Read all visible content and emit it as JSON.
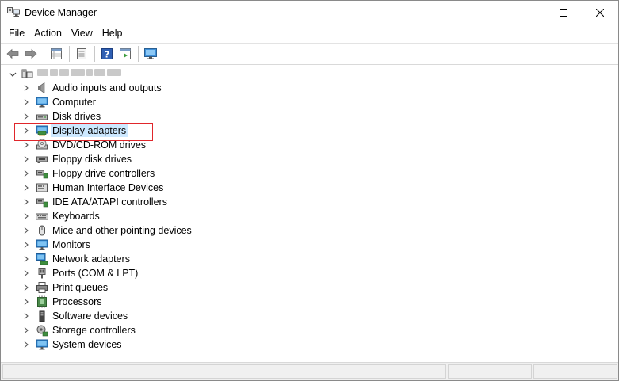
{
  "window": {
    "title": "Device Manager",
    "icon": "device-manager-icon",
    "controls": {
      "minimize": "minimize-icon",
      "maximize": "maximize-icon",
      "close": "close-icon"
    }
  },
  "menu": {
    "items": [
      {
        "label": "File"
      },
      {
        "label": "Action"
      },
      {
        "label": "View"
      },
      {
        "label": "Help"
      }
    ]
  },
  "toolbar": {
    "buttons": [
      "back-arrow-icon",
      "forward-arrow-icon",
      "properties-grid-icon",
      "document-icon",
      "help-icon",
      "run-panel-icon",
      "monitor-scan-icon"
    ]
  },
  "tree": {
    "root": {
      "icon": "computer-icon",
      "label_obscured": true
    },
    "categories": [
      {
        "label": "Audio inputs and outputs",
        "icon": "speaker-icon"
      },
      {
        "label": "Computer",
        "icon": "monitor-icon"
      },
      {
        "label": "Disk drives",
        "icon": "disk-drive-icon"
      },
      {
        "label": "Display adapters",
        "icon": "display-adapter-icon",
        "selected": true
      },
      {
        "label": "DVD/CD-ROM drives",
        "icon": "dvd-icon"
      },
      {
        "label": "Floppy disk drives",
        "icon": "floppy-disk-icon"
      },
      {
        "label": "Floppy drive controllers",
        "icon": "controller-icon"
      },
      {
        "label": "Human Interface Devices",
        "icon": "hid-icon"
      },
      {
        "label": "IDE ATA/ATAPI controllers",
        "icon": "ide-controller-icon"
      },
      {
        "label": "Keyboards",
        "icon": "keyboard-icon"
      },
      {
        "label": "Mice and other pointing devices",
        "icon": "mouse-icon"
      },
      {
        "label": "Monitors",
        "icon": "monitor-icon"
      },
      {
        "label": "Network adapters",
        "icon": "network-adapter-icon"
      },
      {
        "label": "Ports (COM & LPT)",
        "icon": "port-icon"
      },
      {
        "label": "Print queues",
        "icon": "printer-icon"
      },
      {
        "label": "Processors",
        "icon": "processor-icon"
      },
      {
        "label": "Software devices",
        "icon": "software-device-icon"
      },
      {
        "label": "Storage controllers",
        "icon": "storage-controller-icon"
      },
      {
        "label": "System devices",
        "icon": "system-device-icon"
      }
    ]
  },
  "colors": {
    "selection": "#cce8ff",
    "highlight_border": "#e0262b"
  }
}
